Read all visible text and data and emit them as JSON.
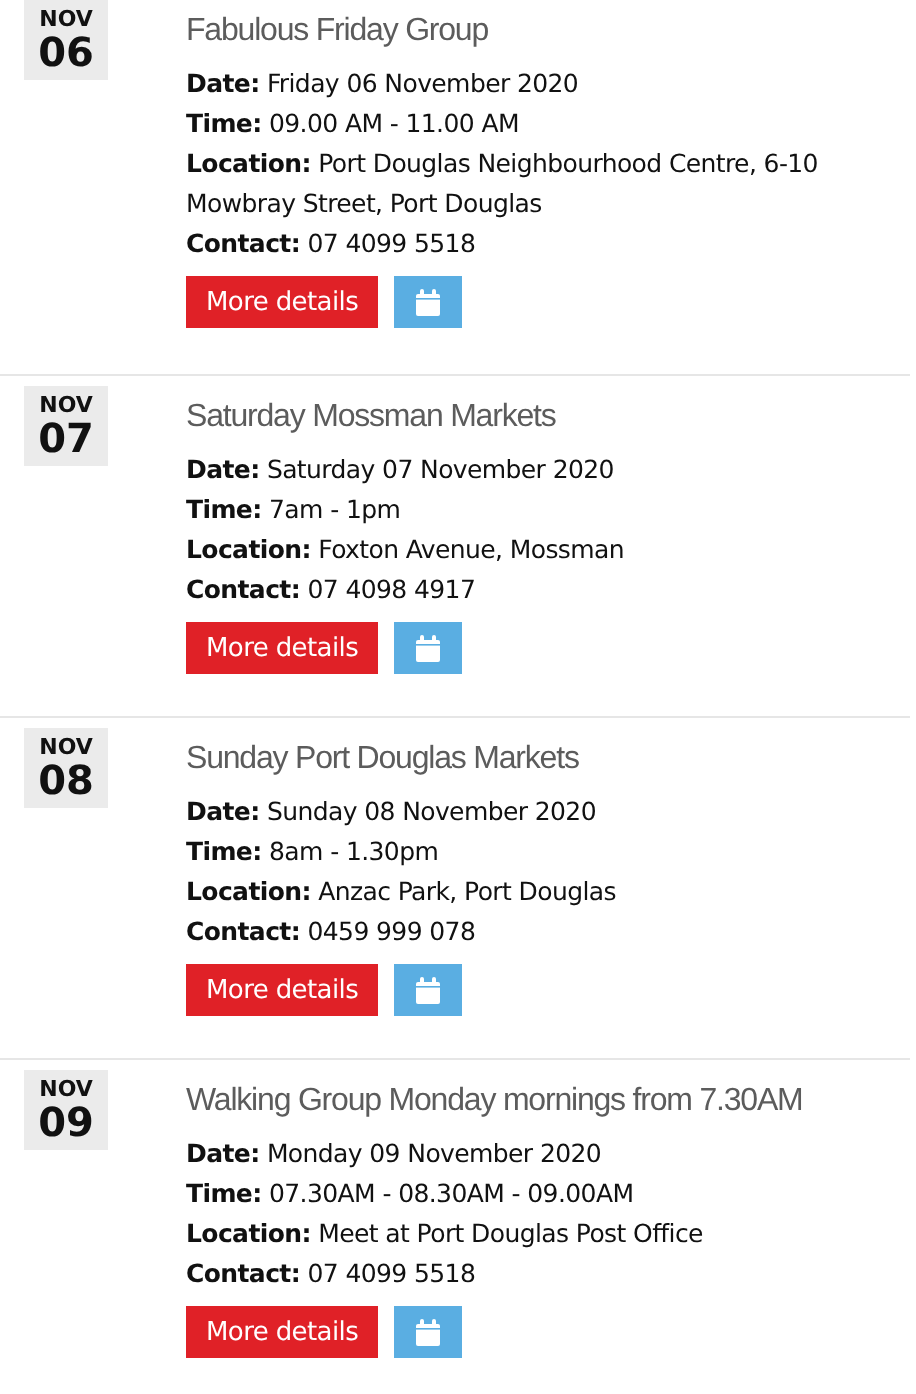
{
  "events": [
    {
      "month": "NOV",
      "day": "06",
      "title": "Fabulous Friday Group",
      "lines": [
        "**Date:** Friday 06 November 2020",
        "**Time:** 09.00 AM - 11.00 AM",
        "**Location:** Port Douglas Neighbourhood Centre, 6-10 Mowbray Street, Port Douglas",
        "**Contact:** 07 4099 5518"
      ],
      "button": "More details"
    },
    {
      "month": "NOV",
      "day": "07",
      "title": "Saturday Mossman Markets",
      "lines": [
        "**Date:** Saturday 07 November 2020",
        "**Time:** 7am - 1pm",
        "**Location:** Foxton Avenue, Mossman",
        "**Contact:** 07 4098 4917"
      ],
      "button": "More details"
    },
    {
      "month": "NOV",
      "day": "08",
      "title": "Sunday Port Douglas Markets",
      "lines": [
        "**Date:** Sunday 08 November 2020",
        "**Time:** 8am - 1.30pm",
        "**Location:** Anzac Park, Port Douglas",
        "**Contact:** 0459 999 078"
      ],
      "button": "More details"
    },
    {
      "month": "NOV",
      "day": "09",
      "title": "Walking Group Monday mornings from 7.30AM",
      "lines": [
        "**Date:** Monday 09 November 2020",
        "**Time:** 07.30AM - 08.30AM - 09.00AM",
        "**Location:** Meet at Port Douglas Post Office",
        "**Contact:** 07 4099 5518"
      ],
      "button": "More details"
    }
  ]
}
